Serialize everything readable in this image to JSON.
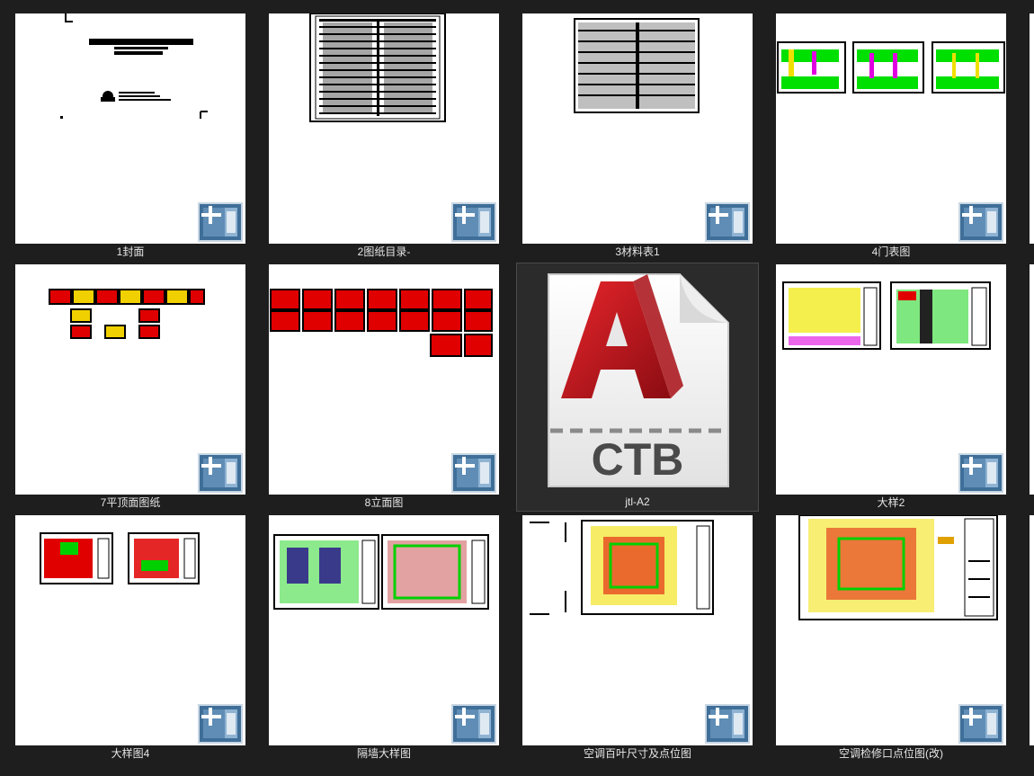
{
  "files": [
    {
      "name": "1封面",
      "icon": "dwg-file-icon"
    },
    {
      "name": "2图纸目录-",
      "icon": "dwg-file-icon"
    },
    {
      "name": "3材料表1",
      "icon": "dwg-file-icon"
    },
    {
      "name": "4门表图",
      "icon": "dwg-file-icon"
    },
    {
      "name": "7平顶面图纸",
      "icon": "dwg-file-icon"
    },
    {
      "name": "8立面图",
      "icon": "dwg-file-icon"
    },
    {
      "name": "jtl-A2",
      "icon": "autocad-ctb-file-icon",
      "badge": "CTB",
      "selected": true
    },
    {
      "name": "大样2",
      "icon": "dwg-file-icon"
    },
    {
      "name": "大样图4",
      "icon": "dwg-file-icon"
    },
    {
      "name": "隔墙大样图",
      "icon": "dwg-file-icon"
    },
    {
      "name": "空调百叶尺寸及点位图",
      "icon": "dwg-file-icon"
    },
    {
      "name": "空调检修口点位图(改)",
      "icon": "dwg-file-icon"
    }
  ],
  "colors": {
    "background": "#1e1e1e",
    "thumbnail": "#ffffff",
    "label": "#e6e6e6",
    "selection": "#2b2b2b",
    "ctb_red": "#c4161c"
  }
}
